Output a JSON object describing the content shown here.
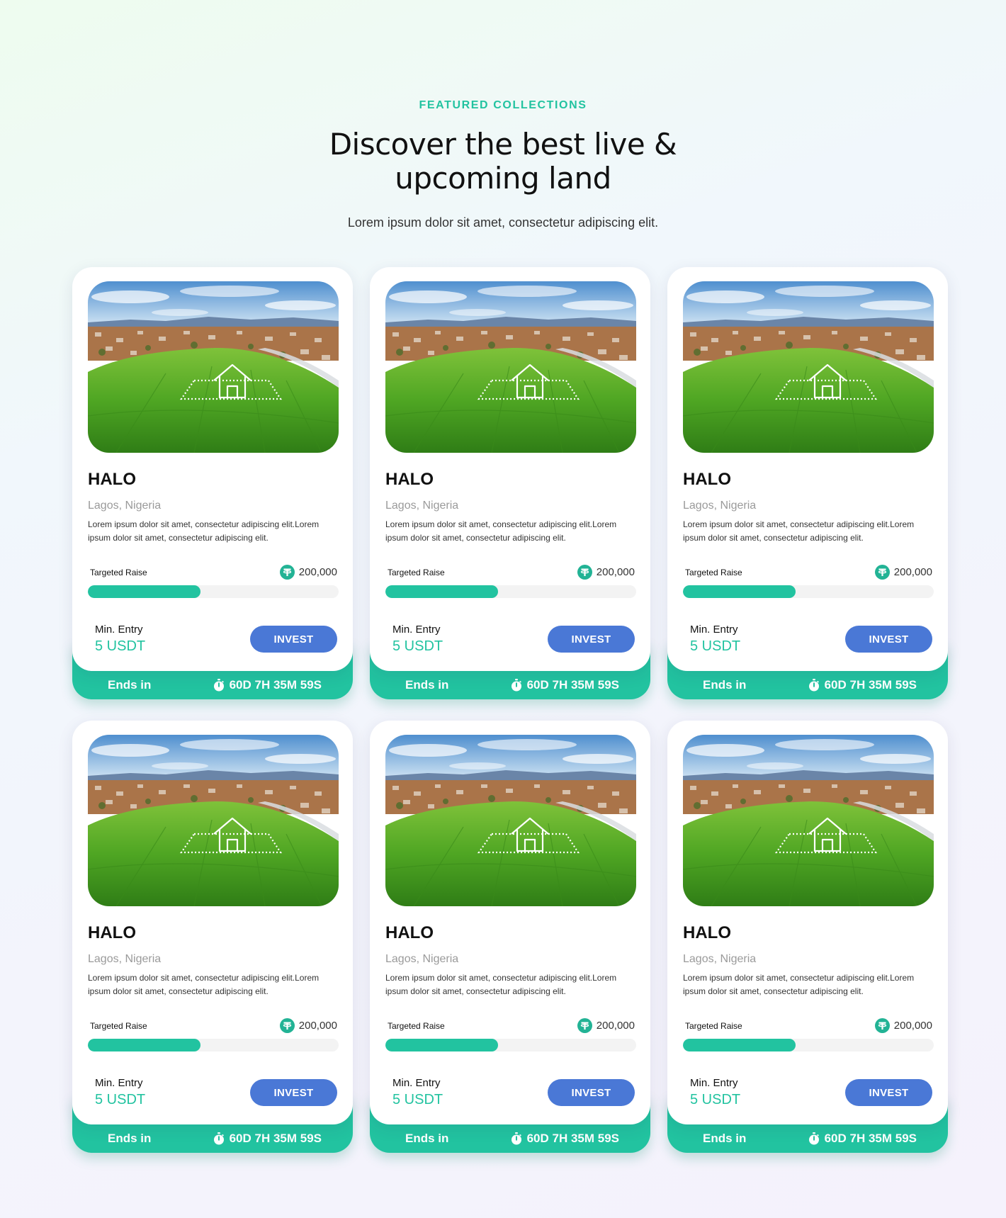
{
  "header": {
    "eyebrow": "FEATURED COLLECTIONS",
    "headline": "Discover the best live & upcoming land",
    "subline": "Lorem ipsum dolor sit amet, consectetur adipiscing elit."
  },
  "cards": [
    {
      "title": "HALO",
      "location": "Lagos, Nigeria",
      "description": "Lorem ipsum dolor sit amet, consectetur adipiscing elit.Lorem ipsum dolor sit amet, consectetur adipiscing elit.",
      "raise_label": "Targeted Raise",
      "raise_amount": "200,000",
      "raise_progress": 0.45,
      "min_entry_label": "Min. Entry",
      "min_entry_value": "5 USDT",
      "invest_label": "INVEST",
      "ends_label": "Ends in",
      "countdown": "60D 7H 35M 59S"
    },
    {
      "title": "HALO",
      "location": "Lagos, Nigeria",
      "description": "Lorem ipsum dolor sit amet, consectetur adipiscing elit.Lorem ipsum dolor sit amet, consectetur adipiscing elit.",
      "raise_label": "Targeted Raise",
      "raise_amount": "200,000",
      "raise_progress": 0.45,
      "min_entry_label": "Min. Entry",
      "min_entry_value": "5 USDT",
      "invest_label": "INVEST",
      "ends_label": "Ends in",
      "countdown": "60D 7H 35M 59S"
    },
    {
      "title": "HALO",
      "location": "Lagos, Nigeria",
      "description": "Lorem ipsum dolor sit amet, consectetur adipiscing elit.Lorem ipsum dolor sit amet, consectetur adipiscing elit.",
      "raise_label": "Targeted Raise",
      "raise_amount": "200,000",
      "raise_progress": 0.45,
      "min_entry_label": "Min. Entry",
      "min_entry_value": "5 USDT",
      "invest_label": "INVEST",
      "ends_label": "Ends in",
      "countdown": "60D 7H 35M 59S"
    },
    {
      "title": "HALO",
      "location": "Lagos, Nigeria",
      "description": "Lorem ipsum dolor sit amet, consectetur adipiscing elit.Lorem ipsum dolor sit amet, consectetur adipiscing elit.",
      "raise_label": "Targeted Raise",
      "raise_amount": "200,000",
      "raise_progress": 0.45,
      "min_entry_label": "Min. Entry",
      "min_entry_value": "5 USDT",
      "invest_label": "INVEST",
      "ends_label": "Ends in",
      "countdown": "60D 7H 35M 59S"
    },
    {
      "title": "HALO",
      "location": "Lagos, Nigeria",
      "description": "Lorem ipsum dolor sit amet, consectetur adipiscing elit.Lorem ipsum dolor sit amet, consectetur adipiscing elit.",
      "raise_label": "Targeted Raise",
      "raise_amount": "200,000",
      "raise_progress": 0.45,
      "min_entry_label": "Min. Entry",
      "min_entry_value": "5 USDT",
      "invest_label": "INVEST",
      "ends_label": "Ends in",
      "countdown": "60D 7H 35M 59S"
    },
    {
      "title": "HALO",
      "location": "Lagos, Nigeria",
      "description": "Lorem ipsum dolor sit amet, consectetur adipiscing elit.Lorem ipsum dolor sit amet, consectetur adipiscing elit.",
      "raise_label": "Targeted Raise",
      "raise_amount": "200,000",
      "raise_progress": 0.45,
      "min_entry_label": "Min. Entry",
      "min_entry_value": "5 USDT",
      "invest_label": "INVEST",
      "ends_label": "Ends in",
      "countdown": "60D 7H 35M 59S"
    }
  ],
  "icons": {
    "coin": "tether-coin-icon",
    "timer": "stopwatch-icon",
    "plot": "house-outline-icon"
  },
  "colors": {
    "accent": "#22c3a0",
    "button": "#4a78d6"
  }
}
